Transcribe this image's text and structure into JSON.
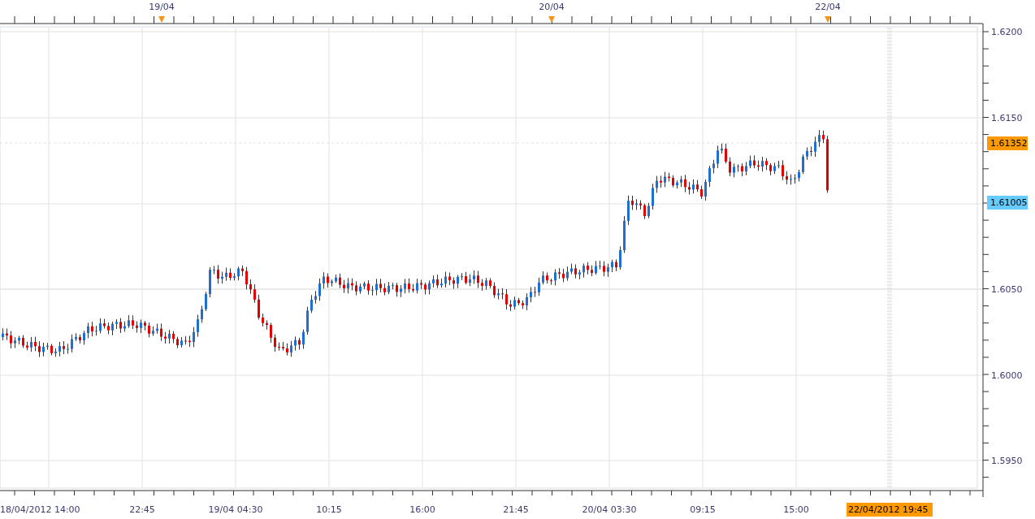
{
  "date_markers": [
    {
      "label": "19/04"
    },
    {
      "label": "20/04"
    },
    {
      "label": "22/04"
    }
  ],
  "price_axis": [
    "1.6200",
    "1.6150",
    "1.6050",
    "1.6000",
    "1.5950"
  ],
  "price_tags": [
    {
      "label": "1.61352",
      "color": "#ff9900"
    },
    {
      "label": "1.61005",
      "color": "#66ccff"
    }
  ],
  "time_axis": [
    "18/04/2012 14:00",
    "22:45",
    "19/04 04:30",
    "10:15",
    "16:00",
    "21:45",
    "20/04 03:30",
    "09:15",
    "15:00"
  ],
  "time_cursor": {
    "label": "22/04/2012 19:45"
  }
}
